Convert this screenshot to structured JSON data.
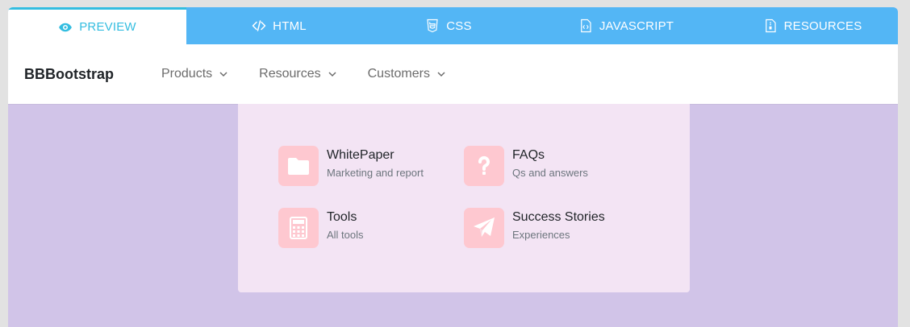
{
  "tabs": [
    {
      "label": "PREVIEW",
      "icon": "eye-icon"
    },
    {
      "label": "HTML",
      "icon": "code-icon"
    },
    {
      "label": "CSS",
      "icon": "css3-icon"
    },
    {
      "label": "JAVASCRIPT",
      "icon": "js-file-icon"
    },
    {
      "label": "RESOURCES",
      "icon": "resource-file-icon"
    }
  ],
  "navbar": {
    "brand": "BBBootstrap",
    "items": [
      {
        "label": "Products"
      },
      {
        "label": "Resources"
      },
      {
        "label": "Customers"
      }
    ]
  },
  "dropdown": {
    "entries": [
      {
        "title": "WhitePaper",
        "subtitle": "Marketing and report",
        "icon": "folder-icon"
      },
      {
        "title": "FAQs",
        "subtitle": "Qs and answers",
        "icon": "question-icon"
      },
      {
        "title": "Tools",
        "subtitle": "All tools",
        "icon": "calculator-icon"
      },
      {
        "title": "Success Stories",
        "subtitle": "Experiences",
        "icon": "paper-plane-icon"
      }
    ]
  },
  "colors": {
    "tab_bar": "#53b6f5",
    "active_tab_text": "#33bde0",
    "page_background": "#d1c4e8",
    "dropdown_background": "#f3e4f4",
    "icon_tile": "#fec8d0"
  }
}
